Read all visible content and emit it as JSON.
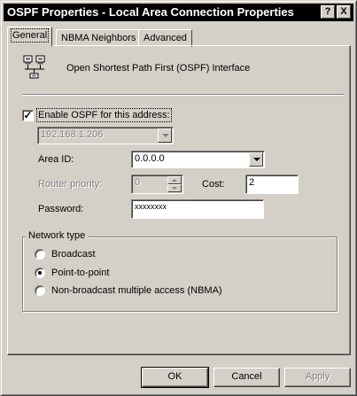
{
  "window": {
    "title": "OSPF Properties - Local Area Connection Properties",
    "help_label": "?",
    "close_label": "X"
  },
  "tabs": [
    {
      "label": "General",
      "active": true
    },
    {
      "label": "NBMA Neighbors",
      "active": false
    },
    {
      "label": "Advanced",
      "active": false
    }
  ],
  "general": {
    "interface_icon": "network-computers-icon",
    "interface_title": "Open Shortest Path First (OSPF) Interface",
    "enable_label": "Enable OSPF for this address:",
    "enable_checked": true,
    "checkmark": "✓",
    "address_value": "192.168.1.206",
    "area_id_label": "Area ID:",
    "area_id_value": "0.0.0.0",
    "router_priority_label": "Router priority:",
    "router_priority_value": "0",
    "cost_label": "Cost:",
    "cost_value": "2",
    "password_label": "Password:",
    "password_value": "xxxxxxxx"
  },
  "network_type": {
    "title": "Network type",
    "options": [
      {
        "label": "Broadcast",
        "selected": false
      },
      {
        "label": "Point-to-point",
        "selected": true
      },
      {
        "label": "Non-broadcast multiple access (NBMA)",
        "selected": false
      }
    ]
  },
  "buttons": {
    "ok": "OK",
    "cancel": "Cancel",
    "apply": "Apply"
  }
}
